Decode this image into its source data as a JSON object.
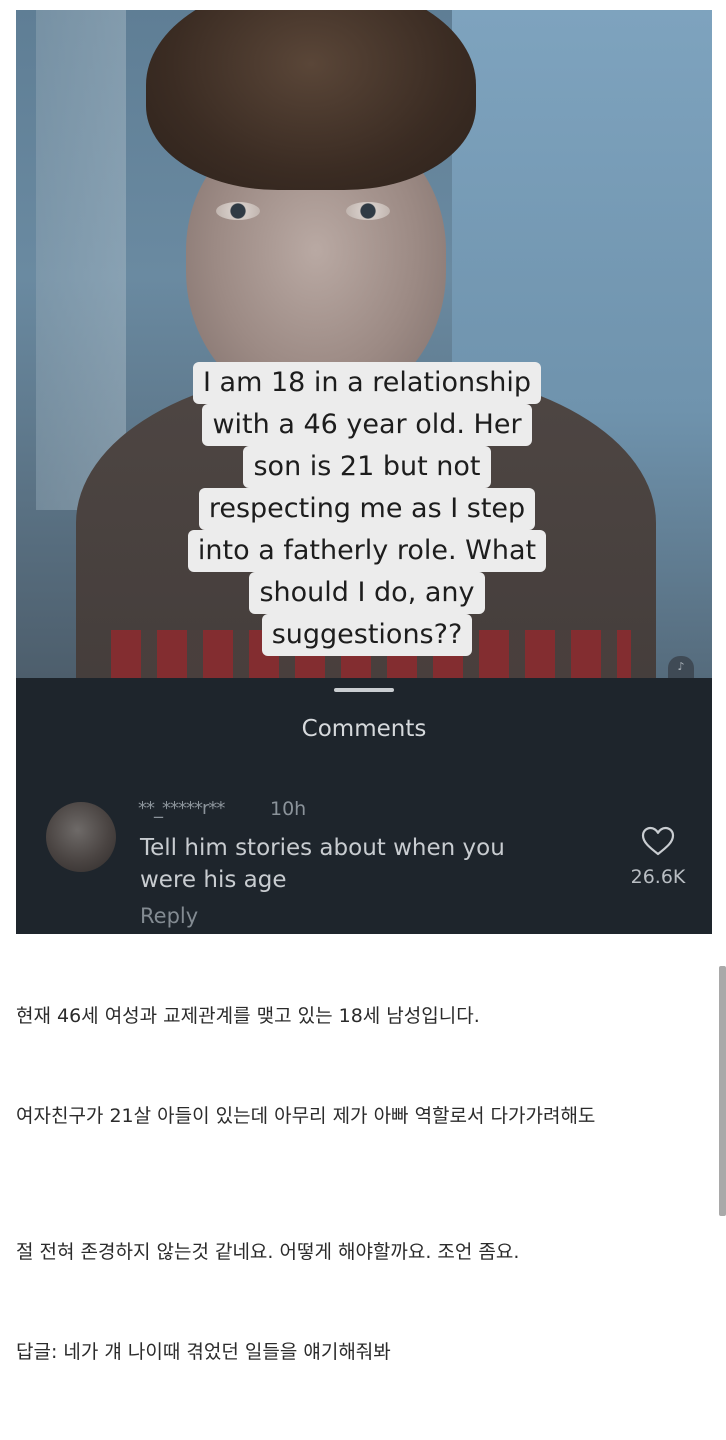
{
  "post": {
    "caption_lines": [
      "I am 18 in a relationship",
      "with a 46 year old. Her",
      "son is 21 but not",
      "respecting me as I step",
      "into a fatherly role. What",
      "should I do, any",
      "suggestions??"
    ]
  },
  "comments_sheet": {
    "title": "Comments",
    "comment": {
      "username": "**_*****r**",
      "time": "10h",
      "text_line1": "Tell him stories about when you",
      "text_line2": "were his age",
      "reply_label": "Reply",
      "like_count": "26.6K"
    }
  },
  "article": {
    "paragraphs": [
      "현재 46세 여성과 교제관계를 맺고 있는 18세 남성입니다.",
      "여자친구가 21살 아들이 있는데 아무리 제가 아빠 역할로서 다가가려해도",
      "절 전혀 존경하지 않는것 같네요. 어떻게 해야할까요. 조언 좀요.",
      "답글: 네가 걔 나이때 겪었던 일들을 얘기해줘봐"
    ]
  },
  "icons": {
    "heart": "heart-icon",
    "sound": "sound-icon"
  },
  "colors": {
    "sheet_bg": "#1e252c",
    "caption_bg": "#ececec"
  }
}
